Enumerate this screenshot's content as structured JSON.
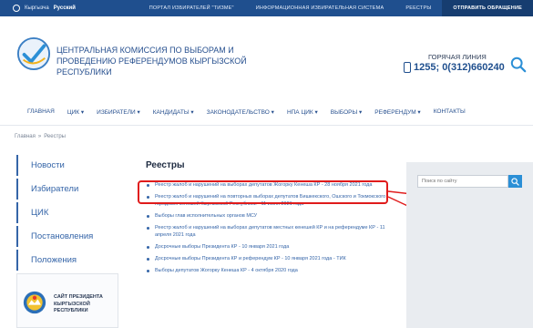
{
  "topbar": {
    "lang_kg": "Кыргызча",
    "lang_ru": "Русский",
    "links": [
      "ПОРТАЛ ИЗБИРАТЕЛЕЙ \"ТИЗМЕ\"",
      "ИНФОРМАЦИОННАЯ ИЗБИРАТЕЛЬНАЯ СИСТЕМА",
      "РЕЕСТРЫ"
    ],
    "appeal": "ОТПРАВИТЬ ОБРАЩЕНИЕ"
  },
  "header": {
    "org_name": "ЦЕНТРАЛЬНАЯ КОМИССИЯ ПО ВЫБОРАМ И ПРОВЕДЕНИЮ РЕФЕРЕНДУМОВ КЫРГЫЗСКОЙ РЕСПУБЛИКИ",
    "hotline_label": "ГОРЯЧАЯ ЛИНИЯ",
    "hotline_number": "1255; 0(312)660240"
  },
  "nav": {
    "items": [
      "ГЛАВНАЯ",
      "ЦИК ▾",
      "ИЗБИРАТЕЛИ ▾",
      "КАНДИДАТЫ ▾",
      "ЗАКОНОДАТЕЛЬСТВО ▾",
      "НПА ЦИК ▾",
      "ВЫБОРЫ ▾",
      "РЕФЕРЕНДУМ ▾",
      "КОНТАКТЫ"
    ]
  },
  "breadcrumb": {
    "home": "Главная",
    "sep": "»",
    "current": "Реестры"
  },
  "sidebar": {
    "items": [
      "Новости",
      "Избиратели",
      "ЦИК",
      "Постановления",
      "Положения"
    ],
    "president": "САЙТ ПРЕЗИДЕНТА КЫРГЫЗСКОЙ РЕСПУБЛИКИ"
  },
  "main": {
    "title": "Реестры",
    "items": [
      "Реестр жалоб и нарушений на выборах депутатов Жогорку Кенеша КР - 28 ноября 2021 года",
      "Реестр жалоб и нарушений на повторных выборах депутатов Бишкекского, Ошского и Токмокского городских кенешей Кыргызской Республики - 11 июля 2021 года",
      "Выборы глав исполнительных органов МСУ",
      "Реестр жалоб и нарушений на выборах депутатов местных кенешей КР и на референдуме КР - 11 апреля 2021 года",
      "Досрочные выборы Президента КР - 10 января 2021 года",
      "Досрочные выборы Президента КР и референдум КР - 10 января 2021 года - ТИК",
      "Выборы депутатов Жогорку Кенеша КР - 4 октября 2020 года"
    ]
  },
  "search": {
    "placeholder": "Поиск по сайту"
  },
  "colors": {
    "topbar": "#1f4f8e",
    "link": "#3565a8",
    "highlight": "#e01b1b",
    "search_button": "#2b8fd6"
  },
  "icons": {
    "lang": "globe-icon",
    "logo": "checkmark-logo-icon",
    "phone": "phone-icon",
    "header_search": "search-icon",
    "emblem": "state-emblem-icon",
    "search_button": "search-icon"
  }
}
